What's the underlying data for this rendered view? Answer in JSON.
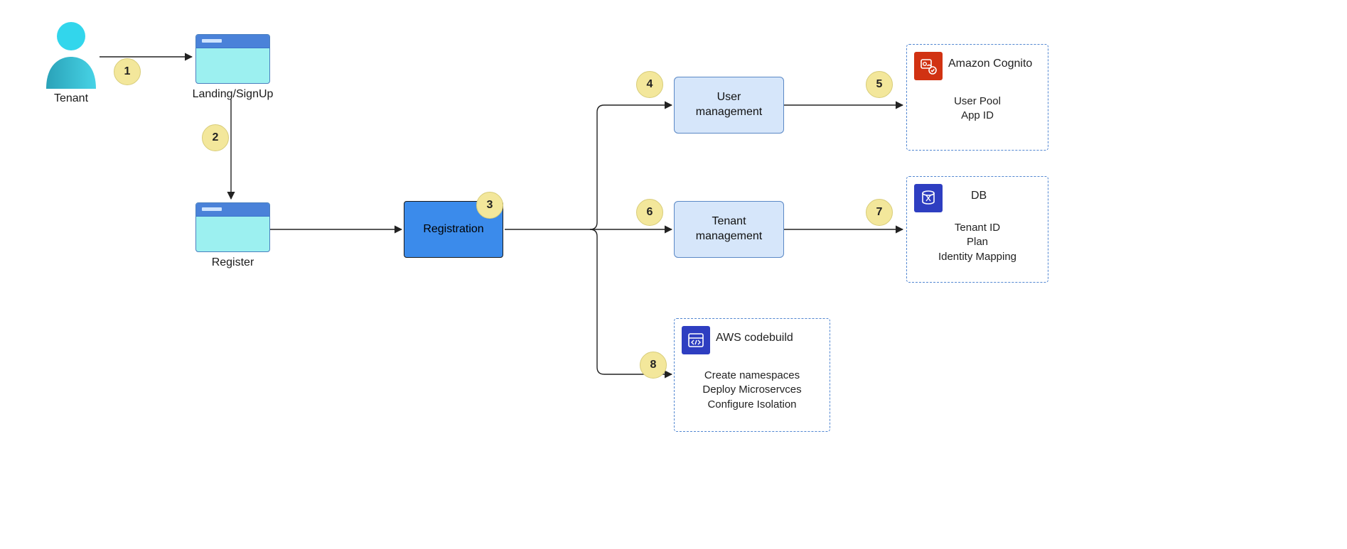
{
  "nodes": {
    "tenant": {
      "label": "Tenant"
    },
    "landing": {
      "label": "Landing/SignUp"
    },
    "register": {
      "label": "Register"
    },
    "registration": {
      "label": "Registration"
    },
    "user_mgmt": {
      "label": "User\nmanagement"
    },
    "tenant_mgmt": {
      "label": "Tenant\nmanagement"
    }
  },
  "callouts": {
    "cognito": {
      "title": "Amazon Cognito",
      "lines": [
        "User Pool",
        "App ID"
      ]
    },
    "db": {
      "title": "DB",
      "lines": [
        "Tenant ID",
        "Plan",
        "Identity Mapping"
      ]
    },
    "codebuild": {
      "title": "AWS codebuild",
      "lines": [
        "Create namespaces",
        "Deploy Microservces",
        "Configure Isolation"
      ]
    }
  },
  "steps": {
    "1": "1",
    "2": "2",
    "3": "3",
    "4": "4",
    "5": "5",
    "6": "6",
    "7": "7",
    "8": "8"
  },
  "icons": {
    "cognito": "cognito-icon",
    "db": "db-icon",
    "codebuild": "codebuild-icon",
    "tenant": "user-icon"
  }
}
